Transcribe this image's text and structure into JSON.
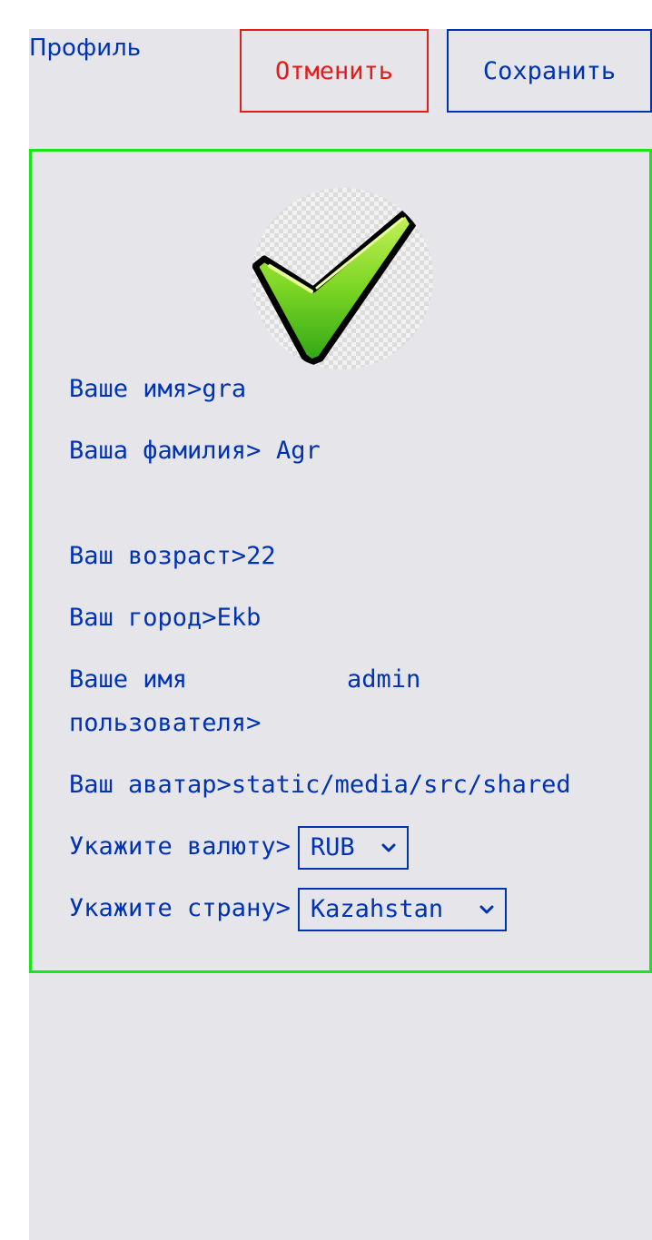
{
  "header": {
    "title": "Профиль",
    "cancel_label": "Отменить",
    "save_label": "Сохранить"
  },
  "profile": {
    "avatar_icon": "checkmark-icon",
    "name_label": "Ваше имя>",
    "name_value": "gra",
    "surname_label": "Ваша фамилия>",
    "surname_value": "Agr",
    "age_label": "Ваш возраст>",
    "age_value": "22",
    "city_label": "Ваш город>",
    "city_value": "Ekb",
    "username_label": "Ваше имя пользователя>",
    "username_value": "admin",
    "avatar_label": "Ваш аватар>",
    "avatar_value": "static/media/src/shared",
    "currency_label": "Укажите валюту>",
    "currency_value": "RUB",
    "country_label": "Укажите страну>",
    "country_value": "Kazahstan"
  },
  "colors": {
    "primary": "#0033b3",
    "danger": "#e41b1b",
    "card_border": "#19e619",
    "background": "#e6e6ea"
  }
}
